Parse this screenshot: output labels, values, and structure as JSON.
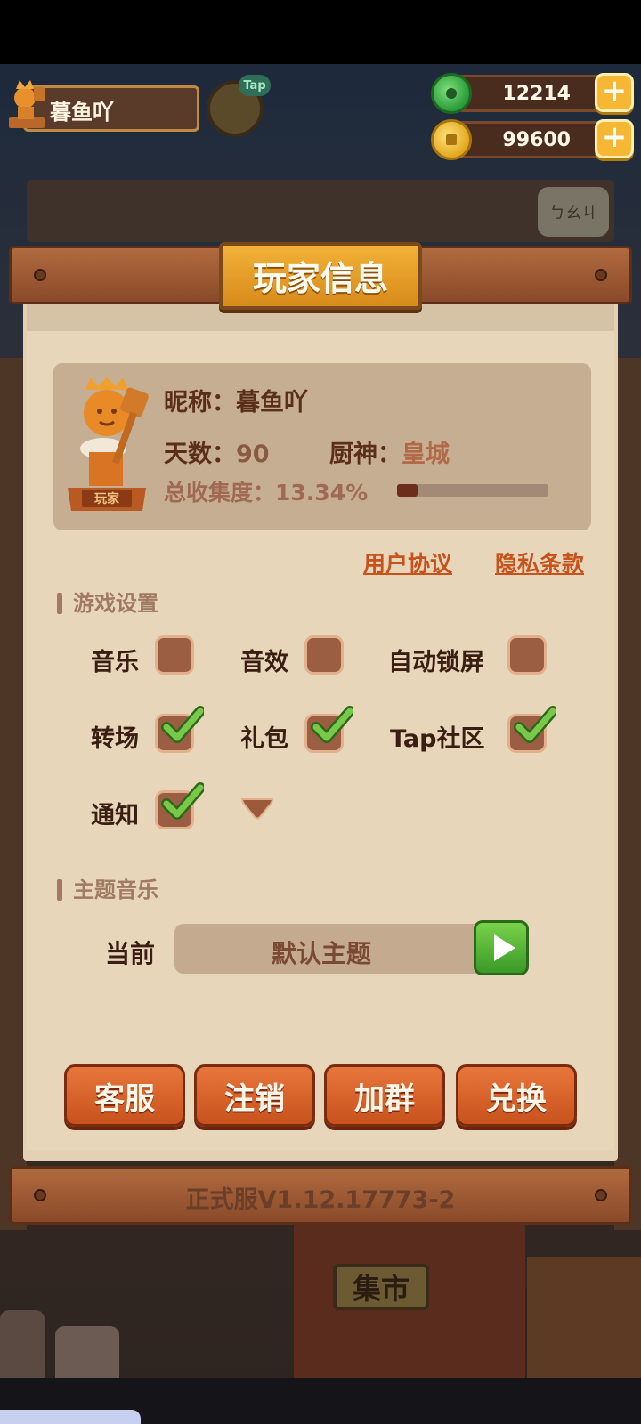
{
  "hud": {
    "player_name": "暮鱼吖",
    "tap_badge": "Tap",
    "jade_amount": "12214",
    "coin_amount": "99600",
    "plus_label": "+"
  },
  "background": {
    "bubble_text": "ㄅㄠㄐ",
    "market_sign": "集市"
  },
  "panel": {
    "title": "玩家信息",
    "statue_label": "玩家",
    "nickname_label": "昵称：",
    "nickname": "暮鱼吖",
    "days_label": "天数：",
    "days": "90",
    "chef_god_label": "厨神：",
    "chef_god": "皇城",
    "collection_label": "总收集度：",
    "collection_value": "13.34%",
    "collection_progress": 0.1334,
    "user_agreement": "用户协议",
    "privacy_policy": "隐私条款"
  },
  "game_settings": {
    "section_title": "游戏设置",
    "items": [
      {
        "label": "音乐",
        "checked": false
      },
      {
        "label": "音效",
        "checked": false
      },
      {
        "label": "自动锁屏",
        "checked": false
      },
      {
        "label": "转场",
        "checked": true
      },
      {
        "label": "礼包",
        "checked": true
      },
      {
        "label": "Tap社区",
        "checked": true
      },
      {
        "label": "通知",
        "checked": true
      }
    ]
  },
  "theme_music": {
    "section_title": "主题音乐",
    "current_label": "当前",
    "current_theme": "默认主题"
  },
  "actions": {
    "customer_service": "客服",
    "logout": "注销",
    "join_group": "加群",
    "redeem": "兑换"
  },
  "version": "正式服V1.12.17773-2",
  "colors": {
    "panel_bg": "#e8d6bb",
    "button_orange": "#d8622a",
    "check_green": "#5aa83a",
    "link_red": "#c8521c"
  }
}
